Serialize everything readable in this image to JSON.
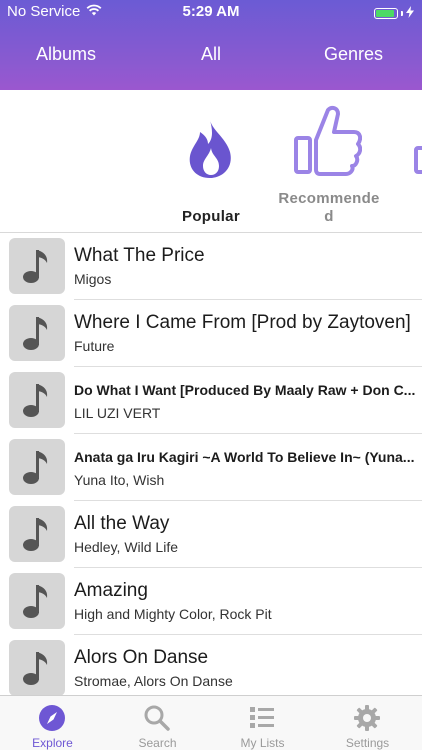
{
  "status": {
    "carrier": "No Service",
    "time": "5:29 AM"
  },
  "nav": {
    "albums": "Albums",
    "all": "All",
    "genres": "Genres"
  },
  "categories": [
    {
      "label": "Popular",
      "icon": "flame-icon"
    },
    {
      "label": "Recommende",
      "label_wrap": "d",
      "icon": "thumbs-up-icon"
    }
  ],
  "songs": [
    {
      "title": "What The Price",
      "artist": "Migos"
    },
    {
      "title": "Where I Came From [Prod by Zaytoven]",
      "artist": "Future"
    },
    {
      "title": "Do What I Want [Produced By Maaly Raw + Don C...",
      "artist": "LIL UZI VERT"
    },
    {
      "title": "Anata ga Iru Kagiri ~A World To Believe In~ (Yuna...",
      "artist": "Yuna Ito, Wish"
    },
    {
      "title": "All the Way",
      "artist": "Hedley, Wild Life"
    },
    {
      "title": "Amazing",
      "artist": "High and Mighty Color, Rock Pit"
    },
    {
      "title": "Alors On Danse",
      "artist": "Stromae, Alors On Danse"
    }
  ],
  "tabbar": {
    "explore": "Explore",
    "search": "Search",
    "my_lists": "My Lists",
    "settings": "Settings"
  },
  "colors": {
    "accent": "#6e57d4",
    "header_top": "#6b5bd4",
    "header_bottom": "#9b57cf"
  }
}
